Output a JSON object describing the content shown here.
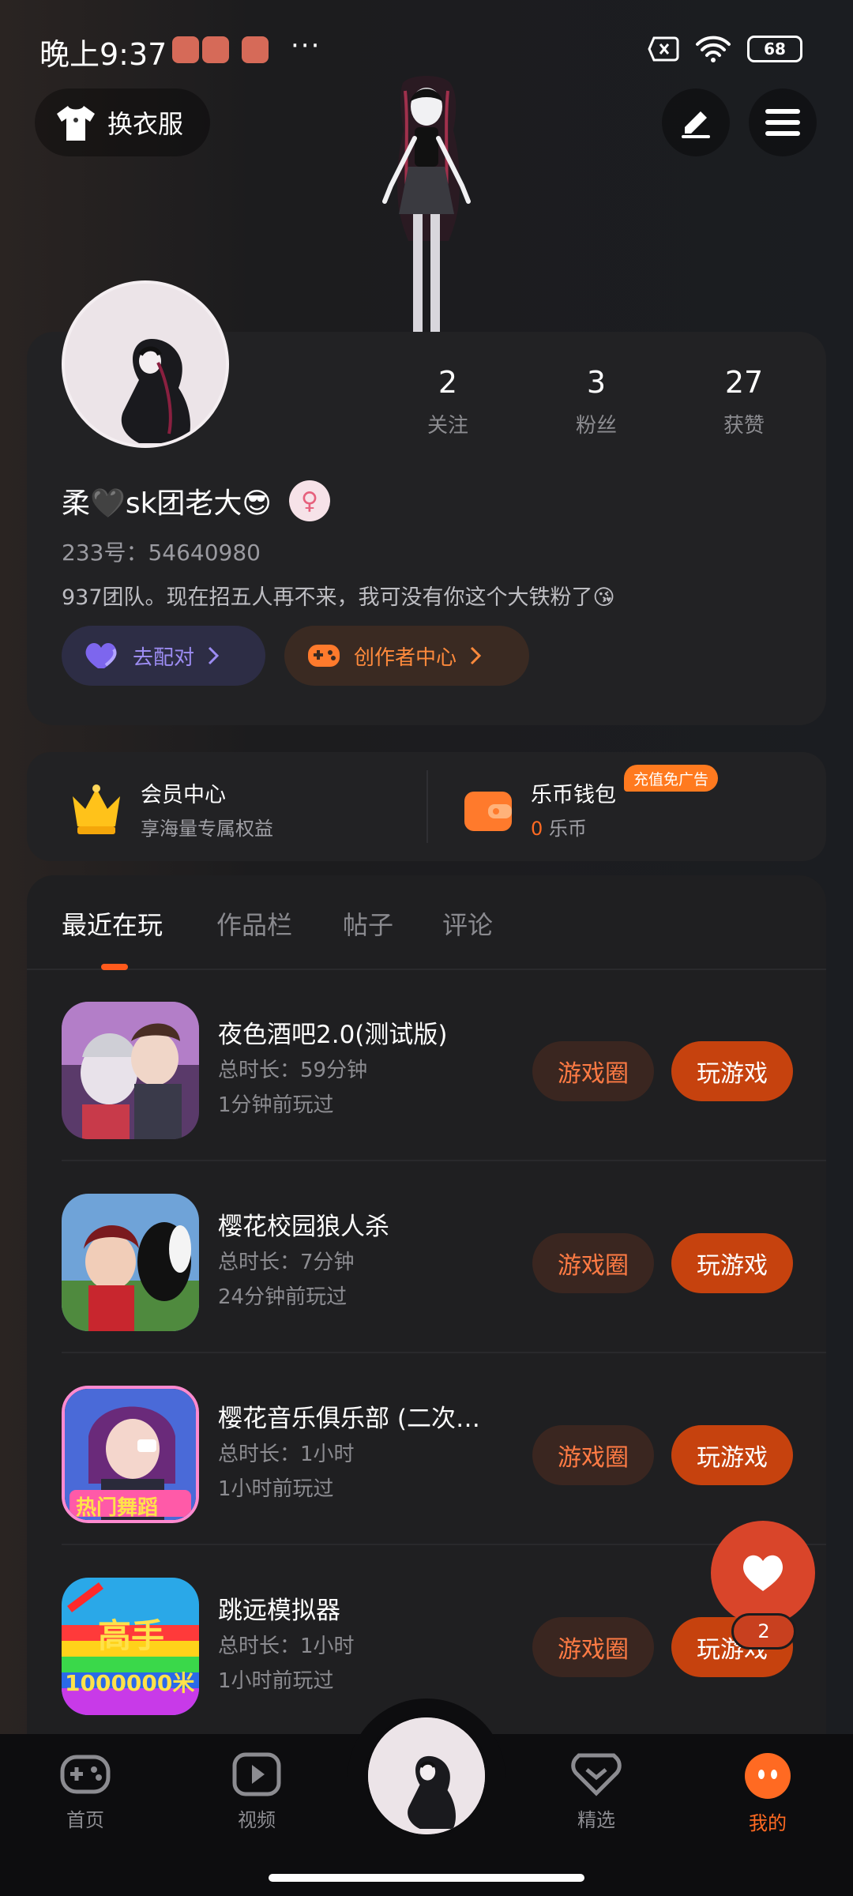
{
  "status_bar": {
    "time": "晚上9:37",
    "more": "···",
    "battery": "68"
  },
  "top": {
    "outfit_label": "换衣服"
  },
  "profile": {
    "stats": [
      {
        "num": "2",
        "label": "关注"
      },
      {
        "num": "3",
        "label": "粉丝"
      },
      {
        "num": "27",
        "label": "获赞"
      }
    ],
    "nickname": "柔🖤sk团老大😎",
    "gender_symbol": "♀",
    "uid": "233号：54640980",
    "bio": "937团队。现在招五人再不来，我可没有你这个大铁粉了😘",
    "match_label": "去配对",
    "creator_label": "创作者中心"
  },
  "vip": {
    "title": "会员中心",
    "subtitle": "享海量专属权益",
    "wallet_title": "乐币钱包",
    "wallet_badge": "充值免广告",
    "coin_amount": "0",
    "coin_unit": "乐币"
  },
  "tabs": [
    "最近在玩",
    "作品栏",
    "帖子",
    "评论"
  ],
  "games": [
    {
      "name": "夜色酒吧2.0(测试版)",
      "duration": "总时长：59分钟",
      "last": "1分钟前玩过",
      "circle": "游戏圈",
      "play": "玩游戏"
    },
    {
      "name": "樱花校园狼人杀",
      "duration": "总时长：7分钟",
      "last": "24分钟前玩过",
      "circle": "游戏圈",
      "play": "玩游戏"
    },
    {
      "name": "樱花音乐俱乐部 (二次…",
      "duration": "总时长：1小时",
      "last": "1小时前玩过",
      "circle": "游戏圈",
      "play": "玩游戏",
      "icon_text": "热门舞蹈"
    },
    {
      "name": "跳远模拟器",
      "duration": "总时长：1小时",
      "last": "1小时前玩过",
      "circle": "游戏圈",
      "play": "玩游戏",
      "icon_text_1": "高手",
      "icon_text_2": "1000000米"
    }
  ],
  "fab": {
    "count": "2"
  },
  "nav": [
    {
      "label": "首页"
    },
    {
      "label": "视频"
    },
    {
      "label": "精选"
    },
    {
      "label": "我的"
    }
  ],
  "colors": {
    "accent": "#ff6a22",
    "play": "#c6420e",
    "match": "#9c8cf2"
  }
}
